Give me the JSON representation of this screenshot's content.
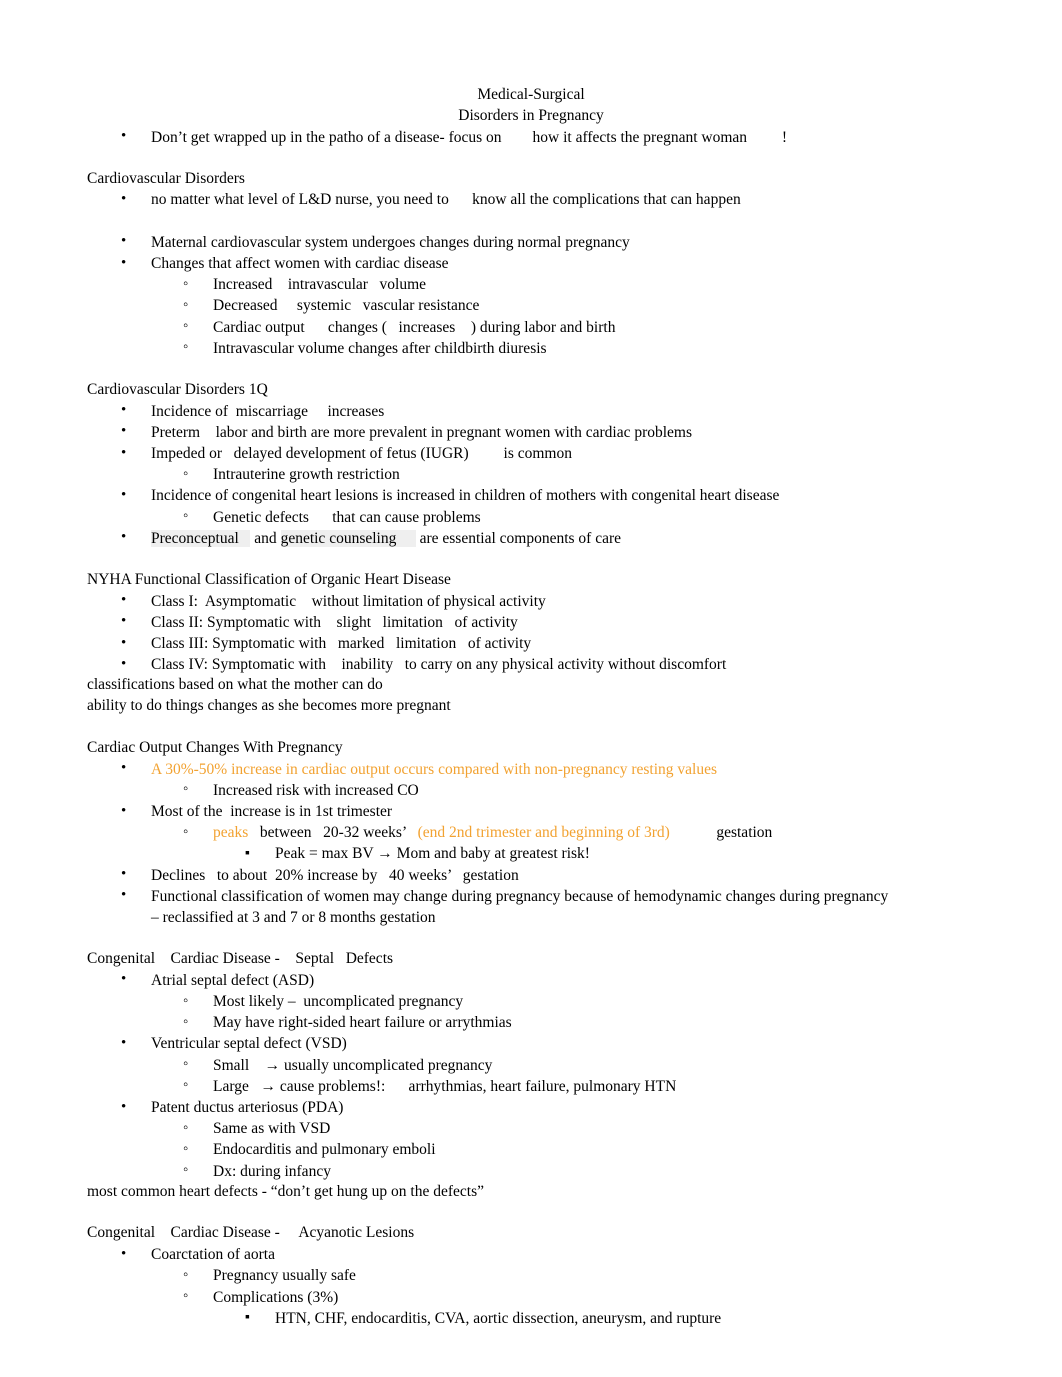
{
  "document": {
    "title_lines": [
      "Medical-Surgical",
      "Disorders in Pregnancy"
    ],
    "intro_bullet": "Don’t get wrapped up in the patho of a disease- focus on        how it affects the pregnant woman         !",
    "sections": [
      {
        "heading": "Cardiovascular Disorders",
        "items": [
          {
            "level": 1,
            "text": "no matter what level of L&D nurse, you need to      know all the complications that can happen"
          },
          {
            "level": 0,
            "text": ""
          },
          {
            "level": 1,
            "text": "Maternal cardiovascular system undergoes changes during normal pregnancy"
          },
          {
            "level": 1,
            "text": "Changes that affect women with cardiac disease"
          },
          {
            "level": 2,
            "text": "Increased    intravascular   volume"
          },
          {
            "level": 2,
            "text": "Decreased     systemic   vascular resistance"
          },
          {
            "level": 2,
            "text": "Cardiac output      changes (   increases    ) during labor and birth"
          },
          {
            "level": 2,
            "text": "Intravascular volume changes after childbirth diuresis"
          }
        ]
      },
      {
        "heading": "Cardiovascular Disorders 1Q",
        "items": [
          {
            "level": 1,
            "text": "Incidence of  miscarriage     increases"
          },
          {
            "level": 1,
            "text": "Preterm    labor and birth are more prevalent in pregnant women with cardiac problems"
          },
          {
            "level": 1,
            "text": "Impeded or   delayed development of fetus (IUGR)         is common"
          },
          {
            "level": 2,
            "text": "Intrauterine growth restriction"
          },
          {
            "level": 1,
            "text": "Incidence of congenital heart lesions is increased in children of mothers with congenital heart disease"
          },
          {
            "level": 2,
            "text": "Genetic defects      that can cause problems"
          },
          {
            "level": 1,
            "highlight": true,
            "parts": [
              {
                "text": "Preconceptual   ",
                "style": "hl"
              },
              {
                "text": " and ",
                "style": "plain"
              },
              {
                "text": "genetic counseling     ",
                "style": "hl"
              },
              {
                "text": " are essential components of care",
                "style": "plain"
              }
            ]
          }
        ]
      },
      {
        "heading": "NYHA Functional Classification of Organic Heart Disease",
        "items": [
          {
            "level": 1,
            "text": "Class I:  Asymptomatic    without limitation of physical activity"
          },
          {
            "level": 1,
            "text": "Class II: Symptomatic with    slight   limitation   of activity"
          },
          {
            "level": 1,
            "text": "Class III: Symptomatic with   marked   limitation   of activity"
          },
          {
            "level": 1,
            "text": "Class IV: Symptomatic with    inability   to carry on any physical activity without discomfort"
          }
        ],
        "trailing_lines": [
          "classifications based on what the mother can do",
          "ability to do things changes as she becomes more pregnant"
        ]
      },
      {
        "heading": "Cardiac Output Changes With Pregnancy",
        "items": [
          {
            "level": 1,
            "parts": [
              {
                "text": "A 30%-50% increase in cardiac output occurs compared with non-pregnancy resting values",
                "style": "orange"
              }
            ]
          },
          {
            "level": 2,
            "text": "Increased risk with increased CO"
          },
          {
            "level": 1,
            "text": "Most of the  increase is in 1st trimester"
          },
          {
            "level": 2,
            "parts": [
              {
                "text": "peaks ",
                "style": "orange"
              },
              {
                "text": "  between   20-32 weeks’   ",
                "style": "plain"
              },
              {
                "text": "(end 2nd trimester and beginning of 3rd)",
                "style": "orange"
              },
              {
                "text": "            gestation",
                "style": "plain"
              }
            ]
          },
          {
            "level": 3,
            "text": "Peak = max BV → Mom and baby at greatest risk!"
          },
          {
            "level": 1,
            "text": "Declines   to about  20% increase by   40 weeks’   gestation"
          },
          {
            "level": 1,
            "text": "Functional classification of women may change during pregnancy because of hemodynamic changes during pregnancy"
          },
          {
            "level": 1,
            "continuation": true,
            "text": "– reclassified at 3 and 7 or 8 months gestation"
          }
        ]
      },
      {
        "heading": "Congenital    Cardiac Disease -    Septal   Defects",
        "items": [
          {
            "level": 1,
            "text": "Atrial septal defect (ASD)"
          },
          {
            "level": 2,
            "text": "Most likely –  uncomplicated pregnancy"
          },
          {
            "level": 2,
            "text": "May have right-sided heart failure or arrythmias"
          },
          {
            "level": 1,
            "text": "Ventricular septal defect (VSD)"
          },
          {
            "level": 2,
            "text": "Small    → usually uncomplicated pregnancy"
          },
          {
            "level": 2,
            "text": "Large   → cause problems!:      arrhythmias, heart failure, pulmonary HTN"
          },
          {
            "level": 1,
            "text": "Patent ductus arteriosus (PDA)"
          },
          {
            "level": 2,
            "text": "Same as with VSD"
          },
          {
            "level": 2,
            "text": "Endocarditis and pulmonary emboli"
          },
          {
            "level": 2,
            "text": "Dx: during infancy"
          }
        ],
        "trailing_lines": [
          "most common heart defects - “don’t get hung up on the defects”"
        ]
      },
      {
        "heading": "Congenital    Cardiac Disease -     Acyanotic Lesions",
        "items": [
          {
            "level": 1,
            "text": "Coarctation of aorta"
          },
          {
            "level": 2,
            "text": "Pregnancy usually safe"
          },
          {
            "level": 2,
            "text": "Complications (3%)"
          },
          {
            "level": 3,
            "text": "HTN, CHF, endocarditis, CVA, aortic dissection, aneurysm, and rupture"
          }
        ]
      }
    ],
    "colors": {
      "accent_orange": "#F2A231",
      "highlight_gray": "#EFEFEF",
      "text": "#000000",
      "background": "#FFFFFF"
    }
  }
}
